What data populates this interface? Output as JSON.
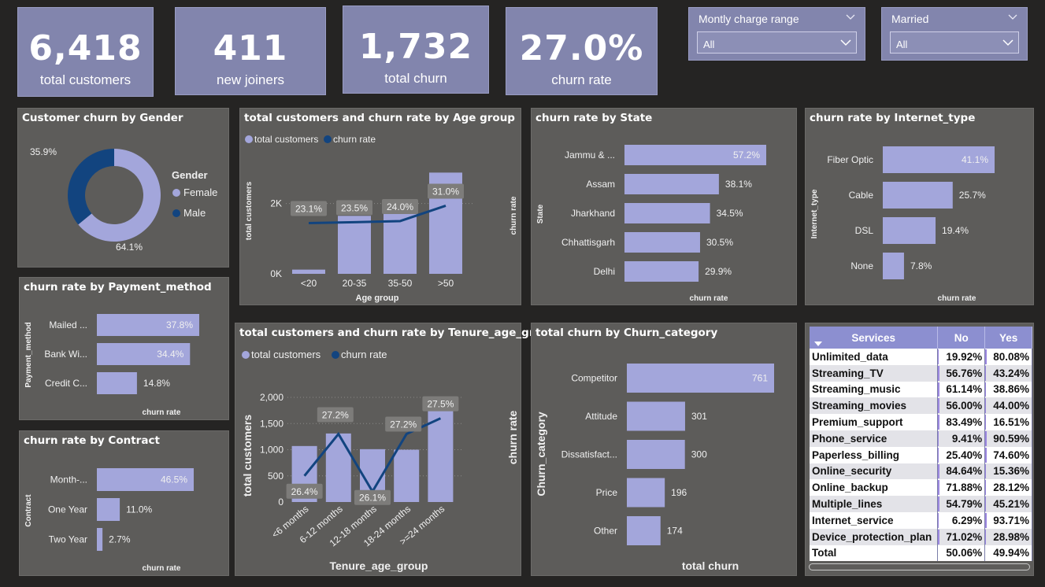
{
  "kpis": [
    {
      "value": "6,418",
      "label": "total customers"
    },
    {
      "value": "411",
      "label": "new joiners"
    },
    {
      "value": "1,732",
      "label": "total churn"
    },
    {
      "value": "27.0%",
      "label": "churn rate"
    }
  ],
  "slicers": [
    {
      "title": "Montly charge range",
      "selected": "All"
    },
    {
      "title": "Married",
      "selected": "All"
    }
  ],
  "colors": {
    "bar": "#a3a6db",
    "line": "#12447f",
    "female": "#a3a6db",
    "male": "#12447f",
    "panel": "#5d5c5a",
    "kpi": "#8285ad"
  },
  "chart_data": [
    {
      "id": "gender",
      "type": "pie",
      "title": "Customer churn by Gender",
      "legend_title": "Gender",
      "categories": [
        "Female",
        "Male"
      ],
      "values": [
        64.1,
        35.9
      ],
      "labels": [
        "64.1%",
        "35.9%"
      ]
    },
    {
      "id": "age",
      "type": "bar",
      "title": "total customers and churn rate by Age group",
      "legend": [
        "total customers",
        "churn rate"
      ],
      "xlabel": "Age group",
      "ylabel": "total customers",
      "y2label": "churn rate",
      "categories": [
        "<20",
        "20-35",
        "35-50",
        ">50"
      ],
      "series": [
        {
          "name": "total customers",
          "values": [
            120,
            1650,
            1780,
            2880
          ]
        },
        {
          "name": "churn rate",
          "values": [
            23.1,
            23.5,
            24.0,
            31.0
          ]
        }
      ],
      "data_labels": [
        "23.1%",
        "23.5%",
        "24.0%",
        "31.0%"
      ],
      "yticks": [
        "0K",
        "2K"
      ],
      "ylim": [
        0,
        3000
      ]
    },
    {
      "id": "state",
      "type": "bar",
      "title": "churn rate by State",
      "ylabel": "State",
      "xlabel": "churn rate",
      "categories": [
        "Jammu & ...",
        "Assam",
        "Jharkhand",
        "Chhattisgarh",
        "Delhi"
      ],
      "values": [
        57.2,
        38.1,
        34.5,
        30.5,
        29.9
      ],
      "labels": [
        "57.2%",
        "38.1%",
        "34.5%",
        "30.5%",
        "29.9%"
      ]
    },
    {
      "id": "internet",
      "type": "bar",
      "title": "churn rate by Internet_type",
      "ylabel": "Internet_type",
      "xlabel": "churn rate",
      "categories": [
        "Fiber Optic",
        "Cable",
        "DSL",
        "None"
      ],
      "values": [
        41.1,
        25.7,
        19.4,
        7.8
      ],
      "labels": [
        "41.1%",
        "25.7%",
        "19.4%",
        "7.8%"
      ]
    },
    {
      "id": "payment",
      "type": "bar",
      "title": "churn rate by Payment_method",
      "ylabel": "Payment_method",
      "xlabel": "churn rate",
      "categories": [
        "Mailed ...",
        "Bank Wi...",
        "Credit C..."
      ],
      "values": [
        37.8,
        34.4,
        14.8
      ],
      "labels": [
        "37.8%",
        "34.4%",
        "14.8%"
      ]
    },
    {
      "id": "contract",
      "type": "bar",
      "title": "churn rate by Contract",
      "ylabel": "Contract",
      "xlabel": "churn rate",
      "categories": [
        "Month-...",
        "One Year",
        "Two Year"
      ],
      "values": [
        46.5,
        11.0,
        2.7
      ],
      "labels": [
        "46.5%",
        "11.0%",
        "2.7%"
      ]
    },
    {
      "id": "tenure",
      "type": "bar",
      "title": "total customers and churn rate by Tenure_age_group",
      "legend": [
        "total customers",
        "churn rate"
      ],
      "xlabel": "Tenure_age_group",
      "ylabel": "total customers",
      "y2label": "churn rate",
      "categories": [
        "<6 months",
        "6-12 months",
        "12-18 months",
        "18-24 months",
        ">=24 months"
      ],
      "series": [
        {
          "name": "total customers",
          "values": [
            1070,
            1310,
            1010,
            1000,
            1900
          ]
        },
        {
          "name": "churn rate",
          "values": [
            26.4,
            27.2,
            26.1,
            27.2,
            27.5
          ]
        }
      ],
      "data_labels": [
        "26.4%",
        "27.2%",
        "26.1%",
        "27.2%",
        "27.5%"
      ],
      "yticks": [
        "0",
        "500",
        "1,000",
        "1,500",
        "2,000"
      ],
      "ylim": [
        0,
        2000
      ]
    },
    {
      "id": "churncat",
      "type": "bar",
      "title": "total churn by Churn_category",
      "ylabel": "Churn_category",
      "xlabel": "total churn",
      "categories": [
        "Competitor",
        "Attitude",
        "Dissatisfact...",
        "Price",
        "Other"
      ],
      "values": [
        761,
        301,
        300,
        196,
        174
      ],
      "labels": [
        "761",
        "301",
        "300",
        "196",
        "174"
      ]
    },
    {
      "id": "services",
      "type": "table",
      "columns": [
        "Services",
        "No",
        "Yes"
      ],
      "rows": [
        [
          "Unlimited_data",
          "19.92%",
          "80.08%"
        ],
        [
          "Streaming_TV",
          "56.76%",
          "43.24%"
        ],
        [
          "Streaming_music",
          "61.14%",
          "38.86%"
        ],
        [
          "Streaming_movies",
          "56.00%",
          "44.00%"
        ],
        [
          "Premium_support",
          "83.49%",
          "16.51%"
        ],
        [
          "Phone_service",
          "9.41%",
          "90.59%"
        ],
        [
          "Paperless_billing",
          "25.40%",
          "74.60%"
        ],
        [
          "Online_security",
          "84.64%",
          "15.36%"
        ],
        [
          "Online_backup",
          "71.88%",
          "28.12%"
        ],
        [
          "Multiple_lines",
          "54.79%",
          "45.21%"
        ],
        [
          "Internet_service",
          "6.29%",
          "93.71%"
        ],
        [
          "Device_protection_plan",
          "71.02%",
          "28.98%"
        ]
      ],
      "total": [
        "Total",
        "50.06%",
        "49.94%"
      ],
      "no_values": [
        19.92,
        56.76,
        61.14,
        56.0,
        83.49,
        9.41,
        25.4,
        84.64,
        71.88,
        54.79,
        6.29,
        71.02
      ],
      "yes_values": [
        80.08,
        43.24,
        38.86,
        44.0,
        16.51,
        90.59,
        74.6,
        15.36,
        28.12,
        45.21,
        93.71,
        28.98
      ]
    }
  ]
}
